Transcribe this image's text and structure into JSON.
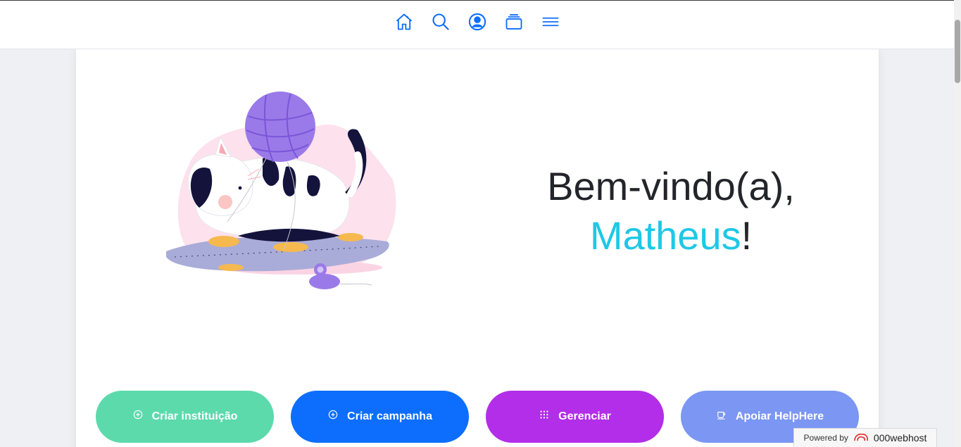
{
  "nav": {
    "icons": [
      "home-icon",
      "search-icon",
      "user-circle-icon",
      "collection-icon",
      "menu-icon"
    ]
  },
  "welcome": {
    "greeting": "Bem-vindo(a),",
    "name": "Matheus",
    "punctuation": "!"
  },
  "buttons": [
    {
      "label": "Criar instituição",
      "icon": "plus-circle-icon",
      "color": "#5cdaac"
    },
    {
      "label": "Criar campanha",
      "icon": "plus-circle-icon",
      "color": "#0d6efd"
    },
    {
      "label": "Gerenciar",
      "icon": "grid-dots-icon",
      "color": "#b22ee8"
    },
    {
      "label": "Apoiar HelpHere",
      "icon": "cup-icon",
      "color": "#7b96f3"
    }
  ],
  "footer": {
    "powered_by": "Powered by",
    "brand": "000webhost"
  },
  "colors": {
    "accent": "#0d6efd",
    "name_highlight": "#1ec8e6"
  }
}
